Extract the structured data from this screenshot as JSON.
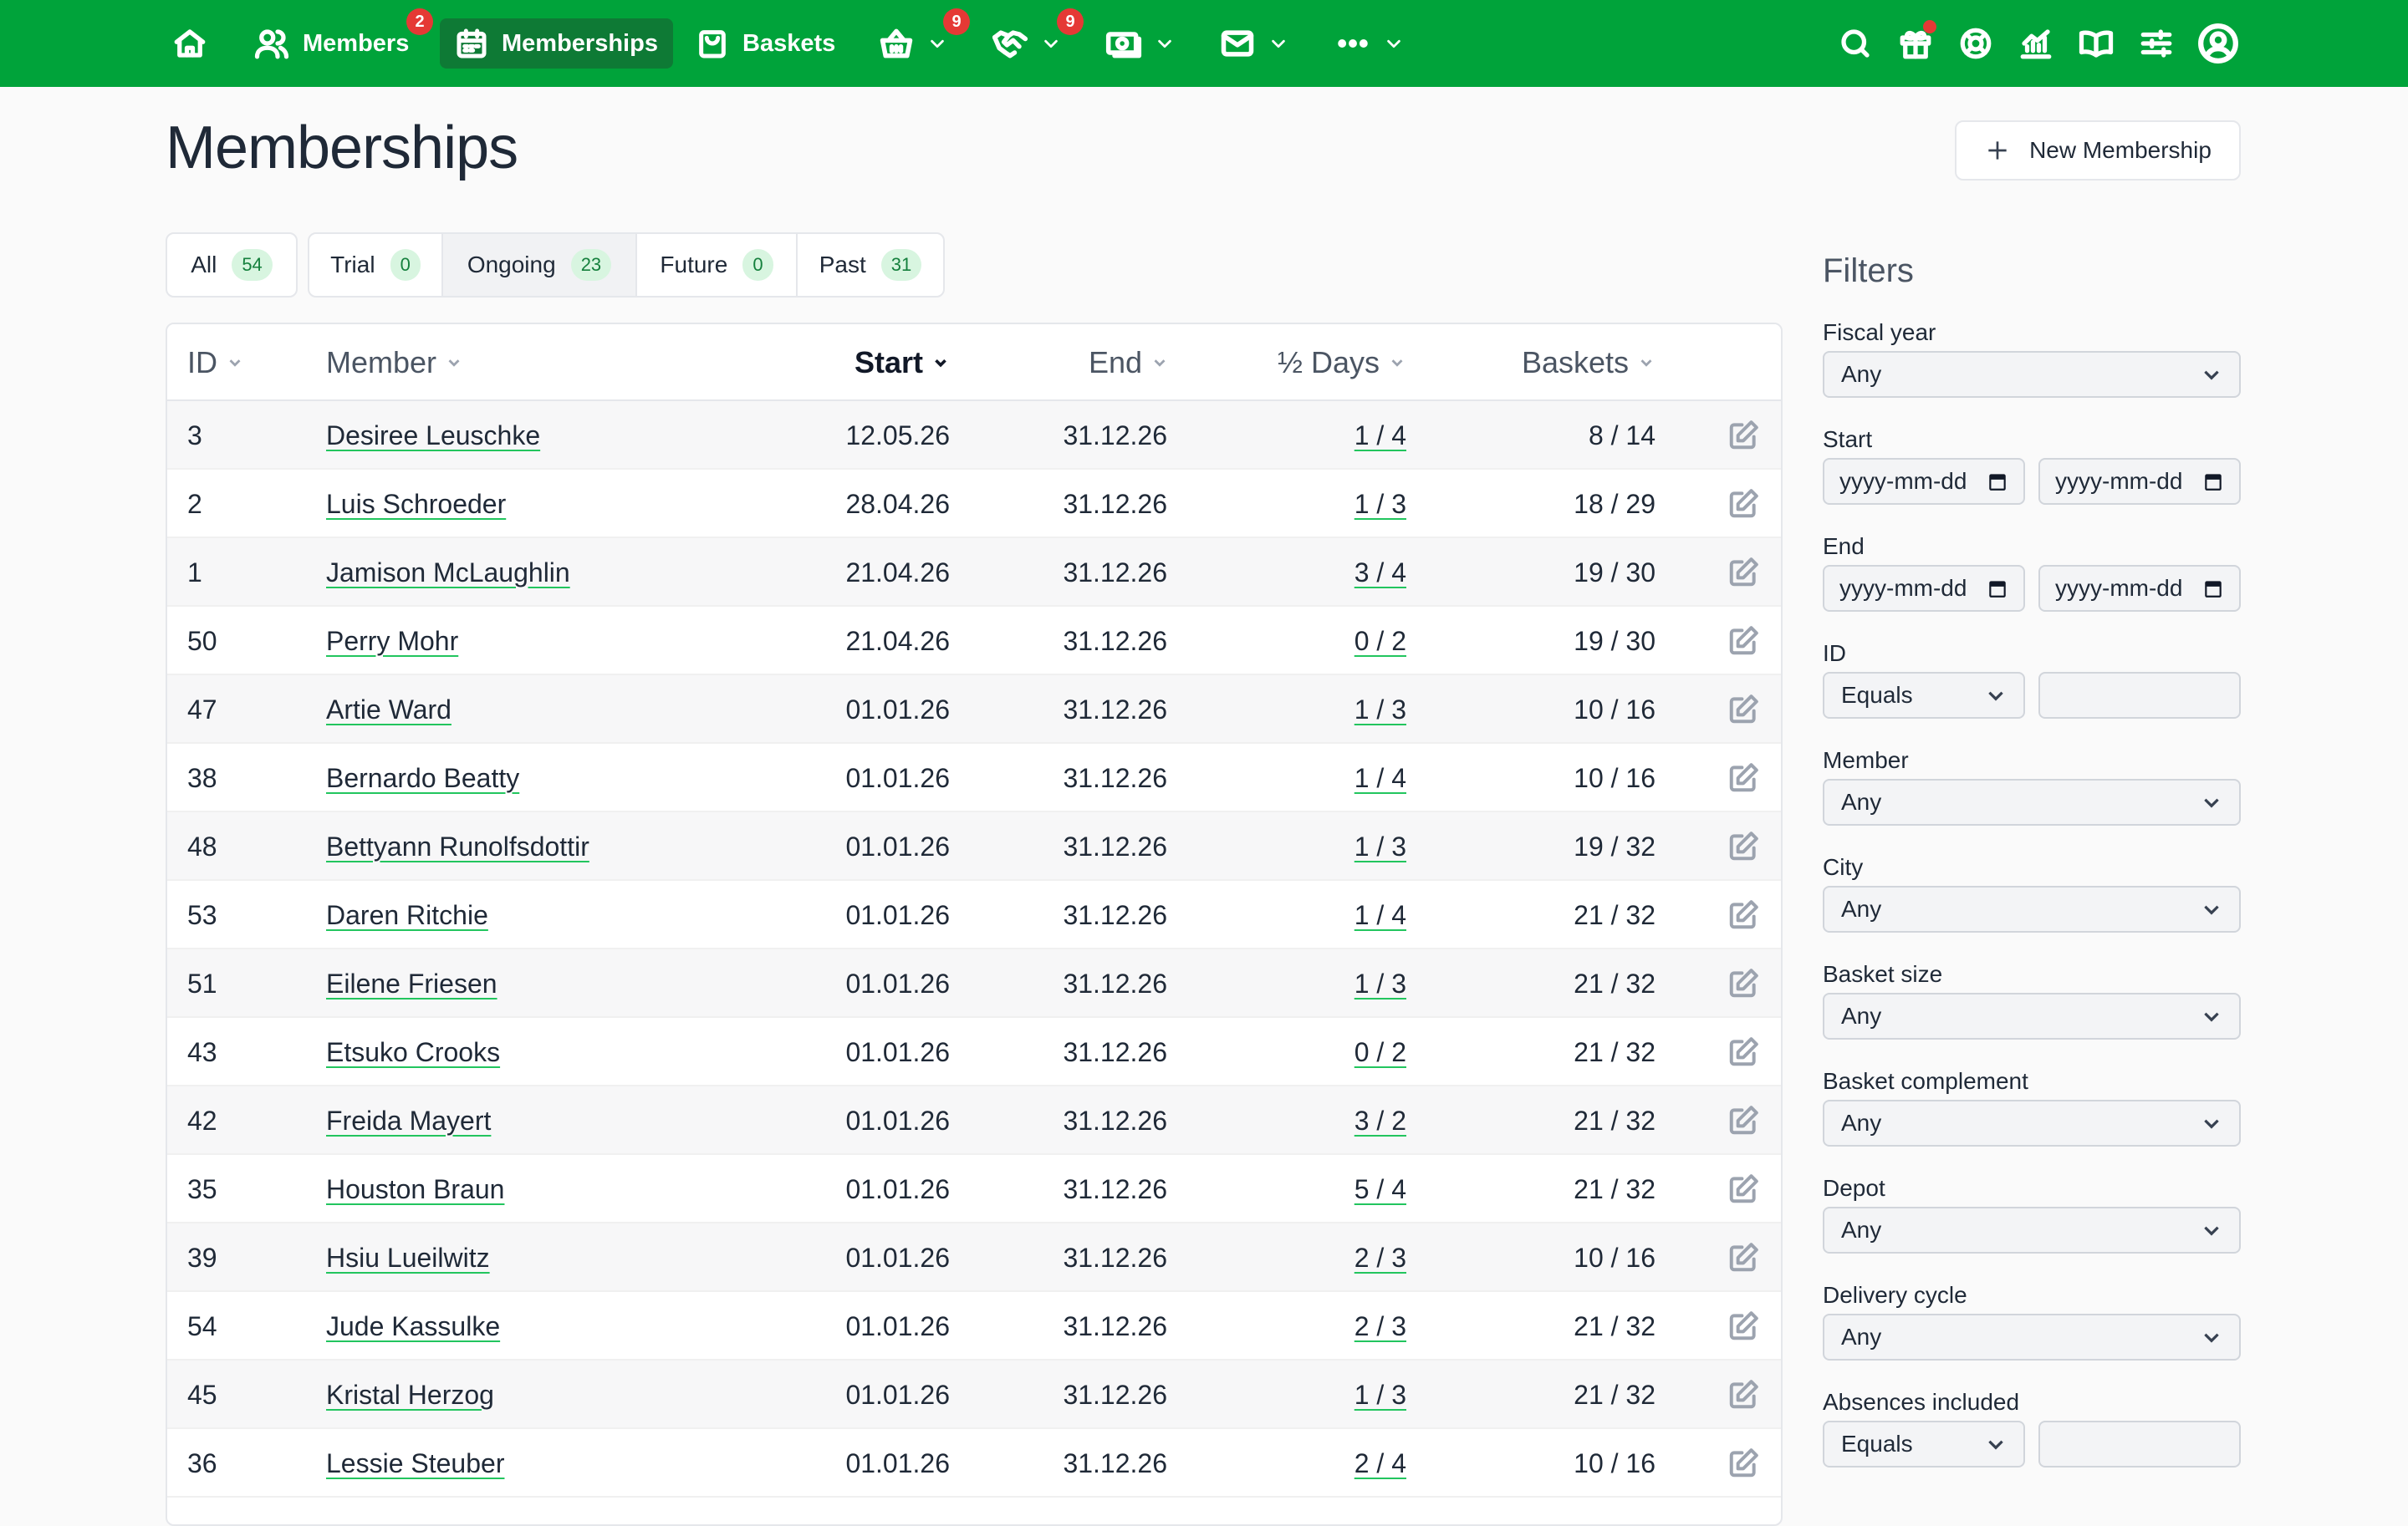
{
  "nav": {
    "members_label": "Members",
    "members_badge": "2",
    "memberships_label": "Memberships",
    "baskets_label": "Baskets",
    "shop_badge": "9",
    "activity_badge": "9"
  },
  "page": {
    "title": "Memberships",
    "new_button": "New Membership"
  },
  "scopes": [
    {
      "label": "All",
      "count": "54"
    },
    {
      "label": "Trial",
      "count": "0"
    },
    {
      "label": "Ongoing",
      "count": "23"
    },
    {
      "label": "Future",
      "count": "0"
    },
    {
      "label": "Past",
      "count": "31"
    }
  ],
  "table": {
    "headers": {
      "id": "ID",
      "member": "Member",
      "start": "Start",
      "end": "End",
      "half_days": "½ Days",
      "baskets": "Baskets"
    },
    "rows": [
      {
        "id": "3",
        "member": "Desiree Leuschke",
        "start": "12.05.26",
        "end": "31.12.26",
        "half_days": "1 / 4",
        "baskets": "8 / 14"
      },
      {
        "id": "2",
        "member": "Luis Schroeder",
        "start": "28.04.26",
        "end": "31.12.26",
        "half_days": "1 / 3",
        "baskets": "18 / 29"
      },
      {
        "id": "1",
        "member": "Jamison McLaughlin",
        "start": "21.04.26",
        "end": "31.12.26",
        "half_days": "3 / 4",
        "baskets": "19 / 30"
      },
      {
        "id": "50",
        "member": "Perry Mohr",
        "start": "21.04.26",
        "end": "31.12.26",
        "half_days": "0 / 2",
        "baskets": "19 / 30"
      },
      {
        "id": "47",
        "member": "Artie Ward",
        "start": "01.01.26",
        "end": "31.12.26",
        "half_days": "1 / 3",
        "baskets": "10 / 16"
      },
      {
        "id": "38",
        "member": "Bernardo Beatty",
        "start": "01.01.26",
        "end": "31.12.26",
        "half_days": "1 / 4",
        "baskets": "10 / 16"
      },
      {
        "id": "48",
        "member": "Bettyann Runolfsdottir",
        "start": "01.01.26",
        "end": "31.12.26",
        "half_days": "1 / 3",
        "baskets": "19 / 32"
      },
      {
        "id": "53",
        "member": "Daren Ritchie",
        "start": "01.01.26",
        "end": "31.12.26",
        "half_days": "1 / 4",
        "baskets": "21 / 32"
      },
      {
        "id": "51",
        "member": "Eilene Friesen",
        "start": "01.01.26",
        "end": "31.12.26",
        "half_days": "1 / 3",
        "baskets": "21 / 32"
      },
      {
        "id": "43",
        "member": "Etsuko Crooks",
        "start": "01.01.26",
        "end": "31.12.26",
        "half_days": "0 / 2",
        "baskets": "21 / 32"
      },
      {
        "id": "42",
        "member": "Freida Mayert",
        "start": "01.01.26",
        "end": "31.12.26",
        "half_days": "3 / 2",
        "baskets": "21 / 32"
      },
      {
        "id": "35",
        "member": "Houston Braun",
        "start": "01.01.26",
        "end": "31.12.26",
        "half_days": "5 / 4",
        "baskets": "21 / 32"
      },
      {
        "id": "39",
        "member": "Hsiu Lueilwitz",
        "start": "01.01.26",
        "end": "31.12.26",
        "half_days": "2 / 3",
        "baskets": "10 / 16"
      },
      {
        "id": "54",
        "member": "Jude Kassulke",
        "start": "01.01.26",
        "end": "31.12.26",
        "half_days": "2 / 3",
        "baskets": "21 / 32"
      },
      {
        "id": "45",
        "member": "Kristal Herzog",
        "start": "01.01.26",
        "end": "31.12.26",
        "half_days": "1 / 3",
        "baskets": "21 / 32"
      },
      {
        "id": "36",
        "member": "Lessie Steuber",
        "start": "01.01.26",
        "end": "31.12.26",
        "half_days": "2 / 4",
        "baskets": "10 / 16"
      }
    ]
  },
  "filters": {
    "title": "Filters",
    "fiscal_year_label": "Fiscal year",
    "fiscal_year_value": "Any",
    "start_label": "Start",
    "end_label": "End",
    "date_placeholder": "yyyy-mm-dd",
    "id_label": "ID",
    "id_operator": "Equals",
    "member_label": "Member",
    "member_value": "Any",
    "city_label": "City",
    "city_value": "Any",
    "basket_size_label": "Basket size",
    "basket_size_value": "Any",
    "basket_complement_label": "Basket complement",
    "basket_complement_value": "Any",
    "depot_label": "Depot",
    "depot_value": "Any",
    "delivery_cycle_label": "Delivery cycle",
    "delivery_cycle_value": "Any",
    "absences_label": "Absences included",
    "absences_operator": "Equals"
  },
  "colors": {
    "brand": "#00a33a",
    "badge": "#e53935",
    "pill_bg": "#d8f5e0"
  }
}
